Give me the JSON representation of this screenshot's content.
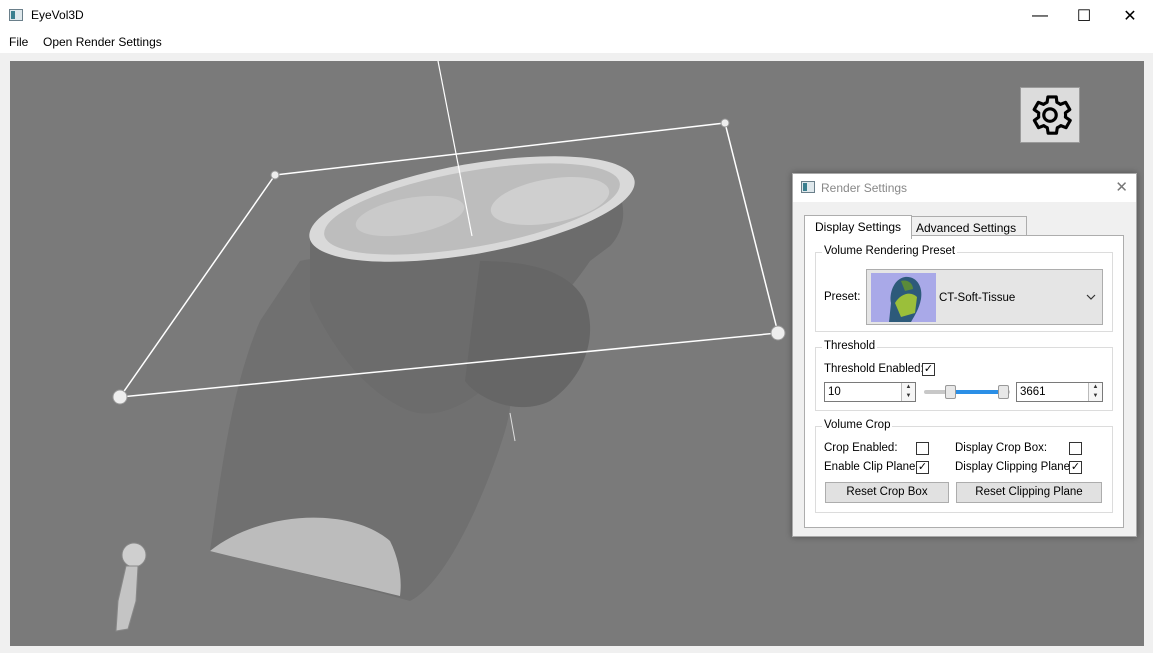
{
  "window": {
    "title": "EyeVol3D",
    "minimize": "—",
    "maximize": "☐",
    "close": "✕"
  },
  "menu": {
    "file": "File",
    "render_settings": "Open Render Settings"
  },
  "dialog": {
    "title": "Render Settings",
    "close": "✕",
    "tabs": [
      "Display Settings",
      "Advanced Settings"
    ],
    "preset_group": "Volume Rendering Preset",
    "preset_label": "Preset:",
    "preset_value": "CT-Soft-Tissue",
    "threshold_group": "Threshold",
    "threshold_enabled_label": "Threshold Enabled:",
    "threshold_enabled_check": "✓",
    "threshold_min": "10",
    "threshold_max": "3661",
    "crop_group": "Volume Crop",
    "crop_enabled_label": "Crop Enabled:",
    "display_crop_box_label": "Display Crop Box:",
    "enable_clip_plane_label": "Enable Clip Plane:",
    "enable_clip_plane_check": "✓",
    "display_clipping_plane_label": "Display Clipping Plane:",
    "display_clipping_plane_check": "✓",
    "reset_crop_box": "Reset Crop Box",
    "reset_clipping_plane": "Reset Clipping Plane"
  }
}
